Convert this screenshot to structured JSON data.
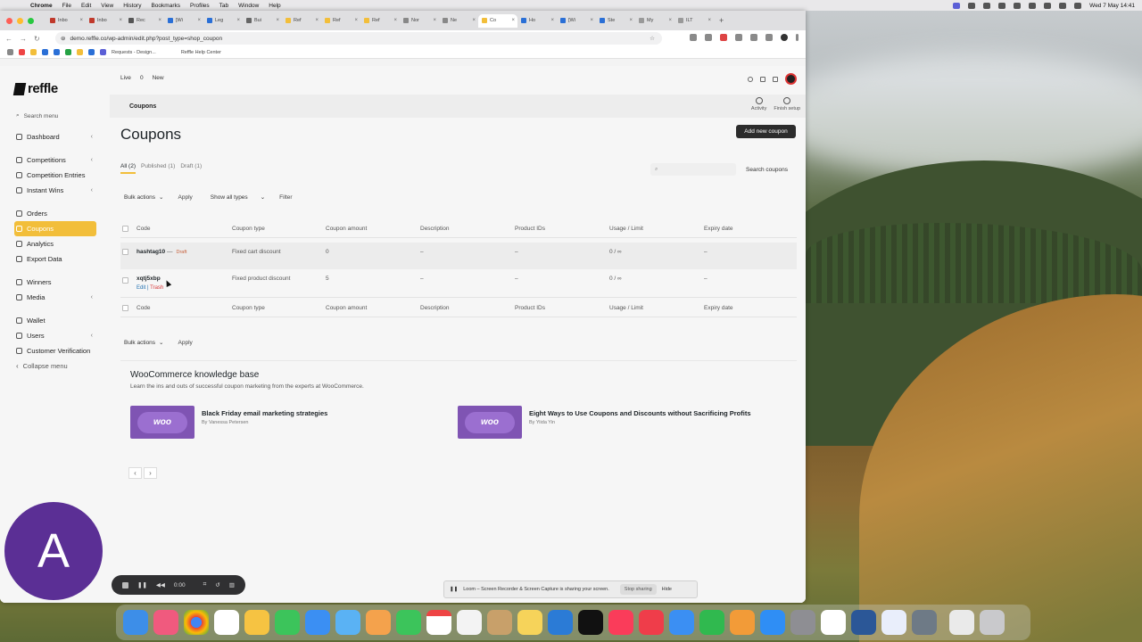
{
  "menubar": {
    "app": "Chrome",
    "items": [
      "File",
      "Edit",
      "View",
      "History",
      "Bookmarks",
      "Profiles",
      "Tab",
      "Window",
      "Help"
    ],
    "datetime": "Wed 7 May 14:41"
  },
  "browser": {
    "tabs": [
      "Inbo",
      "Inbo",
      "Rec",
      "[Wi",
      "Leg",
      "Bui",
      "Ref",
      "Ref",
      "Ref",
      "Nor",
      "Ne",
      "Co",
      "Ho",
      "[Wi",
      "Ste",
      "My",
      "ILT"
    ],
    "url": "demo.reffle.co/wp-admin/edit.php?post_type=shop_coupon",
    "bookmarks": [
      "Requests - Design...",
      "Reffle Help Center"
    ]
  },
  "sidebar": {
    "logo": "reffle",
    "search": "Search menu",
    "items": [
      {
        "label": "Dashboard"
      },
      {
        "label": "Competitions"
      },
      {
        "label": "Competition Entries"
      },
      {
        "label": "Instant Wins"
      },
      {
        "label": "Orders"
      },
      {
        "label": "Coupons"
      },
      {
        "label": "Analytics"
      },
      {
        "label": "Export Data"
      },
      {
        "label": "Winners"
      },
      {
        "label": "Media"
      },
      {
        "label": "Wallet"
      },
      {
        "label": "Users"
      },
      {
        "label": "Customer Verification"
      },
      {
        "label": "Collapse menu"
      }
    ]
  },
  "topbar": {
    "live": "Live",
    "count": "0",
    "new": "New"
  },
  "subbar": {
    "title": "Coupons",
    "activity": "Activity",
    "finish": "Finish setup"
  },
  "main": {
    "heading": "Coupons",
    "add_button": "Add new coupon",
    "filters": {
      "all": "All",
      "all_count": "(2)",
      "published": "Published (1)",
      "draft": "Draft (1)"
    },
    "search_button": "Search coupons",
    "bulk": "Bulk actions",
    "apply": "Apply",
    "types": "Show all types",
    "filter": "Filter",
    "columns": [
      "Code",
      "Coupon type",
      "Coupon amount",
      "Description",
      "Product IDs",
      "Usage / Limit",
      "Expiry date"
    ],
    "rows": [
      {
        "code": "hashtag10",
        "sep": "—",
        "status": "Draft",
        "type": "Fixed cart discount",
        "amount": "0",
        "desc": "–",
        "ids": "–",
        "usage": "0 / ∞",
        "expiry": "–"
      },
      {
        "code": "xqtj5xbp",
        "type": "Fixed product discount",
        "amount": "5",
        "desc": "–",
        "ids": "–",
        "usage": "0 / ∞",
        "expiry": "–",
        "edit": "Edit",
        "trash": "Trash"
      }
    ]
  },
  "kb": {
    "title": "WooCommerce knowledge base",
    "subtitle": "Learn the ins and outs of successful coupon marketing from the experts at WooCommerce.",
    "cards": [
      {
        "thumb": "woo",
        "title": "Black Friday email marketing strategies",
        "author": "By Vanessa Petersen"
      },
      {
        "thumb": "woo",
        "title": "Eight Ways to Use Coupons and Discounts without Sacrificing Profits",
        "author": "By Yiida Yin"
      }
    ],
    "prev": "‹",
    "next": "›"
  },
  "loom": {
    "avatar": "A",
    "time": "0:00",
    "notice": "Loom – Screen Recorder & Screen Capture is sharing your screen.",
    "stop": "Stop sharing",
    "hide": "Hide"
  }
}
